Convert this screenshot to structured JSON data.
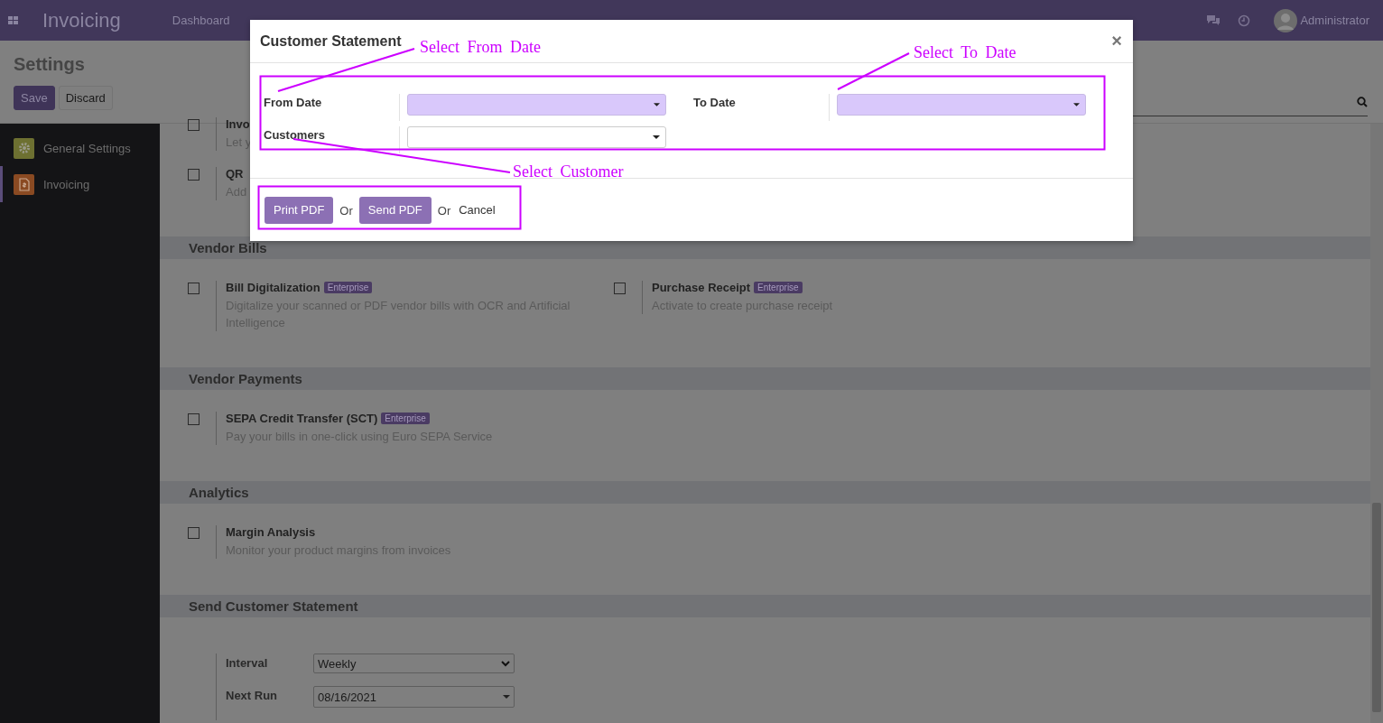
{
  "navbar": {
    "app_title": "Invoicing",
    "menu": [
      "Dashboard"
    ],
    "user": "Administrator"
  },
  "control_panel": {
    "title": "Settings",
    "buttons": [
      {
        "label": "Save",
        "kind": "primary"
      },
      {
        "label": "Discard",
        "kind": "secondary"
      }
    ]
  },
  "sidebar": {
    "items": [
      {
        "label": "General Settings",
        "color": "#6d7031",
        "selected": false
      },
      {
        "label": "Invoicing",
        "color": "#8a4a22",
        "selected": true
      }
    ]
  },
  "sections": [
    {
      "settings": [
        {
          "title": "Invo",
          "description": "Let y",
          "checked": false
        },
        {
          "title": "QR",
          "description": "Add",
          "checked": false
        }
      ]
    },
    {
      "title": "Vendor Bills",
      "settings": [
        {
          "title": "Bill Digitalization",
          "badge": "Enterprise",
          "description": "Digitalize your scanned or PDF vendor bills with OCR and Artificial Intelligence",
          "checked": false
        },
        {
          "title": "Purchase Receipt",
          "badge": "Enterprise",
          "description": "Activate to create purchase receipt",
          "checked": false
        }
      ]
    },
    {
      "title": "Vendor Payments",
      "settings": [
        {
          "title": "SEPA Credit Transfer (SCT)",
          "badge": "Enterprise",
          "description": "Pay your bills in one-click using Euro SEPA Service",
          "checked": false
        }
      ]
    },
    {
      "title": "Analytics",
      "settings": [
        {
          "title": "Margin Analysis",
          "description": "Monitor your product margins from invoices",
          "checked": false
        }
      ]
    },
    {
      "title": "Send Customer Statement",
      "fields": [
        {
          "label": "Interval",
          "value": "Weekly",
          "kind": "select"
        },
        {
          "label": "Next Run",
          "value": "08/16/2021",
          "kind": "date"
        }
      ]
    }
  ],
  "modal": {
    "title": "Customer Statement",
    "close": "×",
    "fields": [
      {
        "label": "From Date",
        "kind": "date",
        "required": true
      },
      {
        "label": "To Date",
        "kind": "date",
        "required": true
      },
      {
        "label": "Customers",
        "kind": "many2one",
        "required": false
      }
    ],
    "actions": [
      {
        "label": "Print PDF",
        "kind": "primary"
      },
      {
        "label": "Or",
        "kind": "separator"
      },
      {
        "label": "Send PDF",
        "kind": "primary"
      },
      {
        "label": "Or",
        "kind": "separator"
      },
      {
        "label": "Cancel",
        "kind": "link"
      }
    ]
  },
  "annotations": [
    "Select From Date",
    "Select To Date",
    "Select Customer"
  ]
}
